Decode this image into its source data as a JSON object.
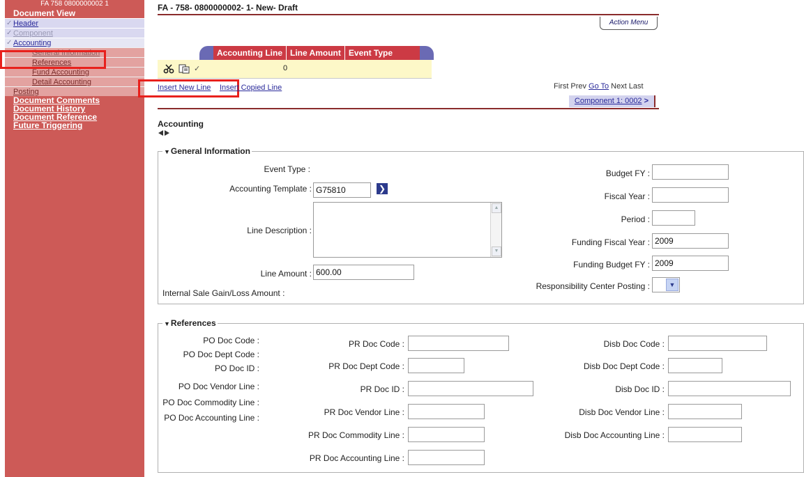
{
  "sidebar": {
    "doc_id": "FA 758 0800000002 1",
    "document_view": "Document View",
    "items": {
      "header": "Header",
      "component": "Component",
      "accounting": "Accounting"
    },
    "accounting_subs": {
      "general_information": "General Information",
      "references": "References",
      "fund_accounting": "Fund Accounting",
      "detail_accounting": "Detail Accounting"
    },
    "posting": "Posting",
    "sections": {
      "document_comments": "Document Comments",
      "document_history": "Document History",
      "document_reference": "Document Reference",
      "future_triggering": "Future Triggering"
    }
  },
  "header": {
    "title": "FA - 758- 0800000002- 1- New- Draft",
    "action_menu": "Action Menu"
  },
  "grid": {
    "columns": [
      "Accounting Line",
      "Line Amount",
      "Event Type"
    ],
    "row": {
      "line_amount": "0"
    },
    "icons": [
      "scissors-icon",
      "paste-icon",
      "check-icon"
    ]
  },
  "links": {
    "insert_new_line": "Insert New Line",
    "insert_copied_line": "Insert Copied Line"
  },
  "pager": {
    "first": "First",
    "prev": "Prev",
    "go_to": "Go To",
    "next": "Next",
    "last": "Last"
  },
  "component_button": {
    "label": "Component 1: 0002",
    "arrow": ">"
  },
  "section": {
    "title": "Accounting"
  },
  "general_information": {
    "legend": "General Information",
    "event_type_label": "Event Type :",
    "accounting_template_label": "Accounting Template :",
    "accounting_template_value": "G75810",
    "line_description_label": "Line Description :",
    "line_amount_label": "Line Amount :",
    "line_amount_value": "600.00",
    "internal_sale_label": "Internal Sale Gain/Loss Amount :",
    "budget_fy_label": "Budget FY :",
    "fiscal_year_label": "Fiscal Year :",
    "period_label": "Period :",
    "funding_fiscal_year_label": "Funding Fiscal Year :",
    "funding_fiscal_year_value": "2009",
    "funding_budget_fy_label": "Funding Budget FY :",
    "funding_budget_fy_value": "2009",
    "responsibility_center_label": "Responsibility Center Posting :"
  },
  "references": {
    "legend": "References",
    "po_labels": {
      "doc_code": "PO Doc Code :",
      "dept_code": "PO Doc Dept Code :",
      "doc_id": "PO Doc ID :",
      "vendor_line": "PO Doc Vendor Line :",
      "commodity_line": "PO Doc Commodity Line :",
      "accounting_line": "PO Doc Accounting Line :"
    },
    "pr_labels": {
      "doc_code": "PR Doc Code :",
      "dept_code": "PR Doc Dept Code :",
      "doc_id": "PR Doc ID :",
      "vendor_line": "PR Doc Vendor Line :",
      "commodity_line": "PR Doc Commodity Line :",
      "accounting_line": "PR Doc Accounting Line :"
    },
    "disb_labels": {
      "doc_code": "Disb Doc Code :",
      "dept_code": "Disb Doc Dept Code :",
      "doc_id": "Disb Doc ID :",
      "vendor_line": "Disb Doc Vendor Line :",
      "accounting_line": "Disb Doc Accounting Line :"
    }
  },
  "colors": {
    "sidebar_bg": "#cd5a57",
    "grid_header": "#cc3a44",
    "highlight": "#e8201c",
    "rule": "#8a2b2b"
  }
}
